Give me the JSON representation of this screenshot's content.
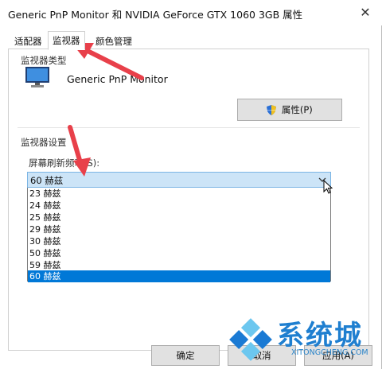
{
  "window": {
    "title": "Generic PnP Monitor 和 NVIDIA GeForce GTX 1060 3GB 属性",
    "close_glyph": "✕"
  },
  "tabs": [
    {
      "label": "适配器"
    },
    {
      "label": "监视器"
    },
    {
      "label": "颜色管理"
    }
  ],
  "active_tab": "监视器",
  "monitor_type": {
    "group_label": "监视器类型",
    "name": "Generic PnP Monitor",
    "icon": "monitor-icon",
    "properties_button": "属性(P)"
  },
  "monitor_settings": {
    "group_label": "监视器设置",
    "refresh_label": "屏幕刷新频率(S):",
    "selected_value": "60 赫兹",
    "options": [
      "23 赫兹",
      "24 赫兹",
      "25 赫兹",
      "29 赫兹",
      "30 赫兹",
      "50 赫兹",
      "59 赫兹",
      "60 赫兹"
    ],
    "highlighted_option": "60 赫兹"
  },
  "footer": {
    "ok_label": "确定",
    "cancel_label": "取消",
    "apply_label": "应用(A)"
  },
  "watermark": {
    "text": "系统城",
    "url": "XITONGCHENG.COM"
  },
  "colors": {
    "accent": "#0078d7",
    "annotation_arrow": "#e8404a",
    "watermark_blue": "#1f7fd0"
  }
}
